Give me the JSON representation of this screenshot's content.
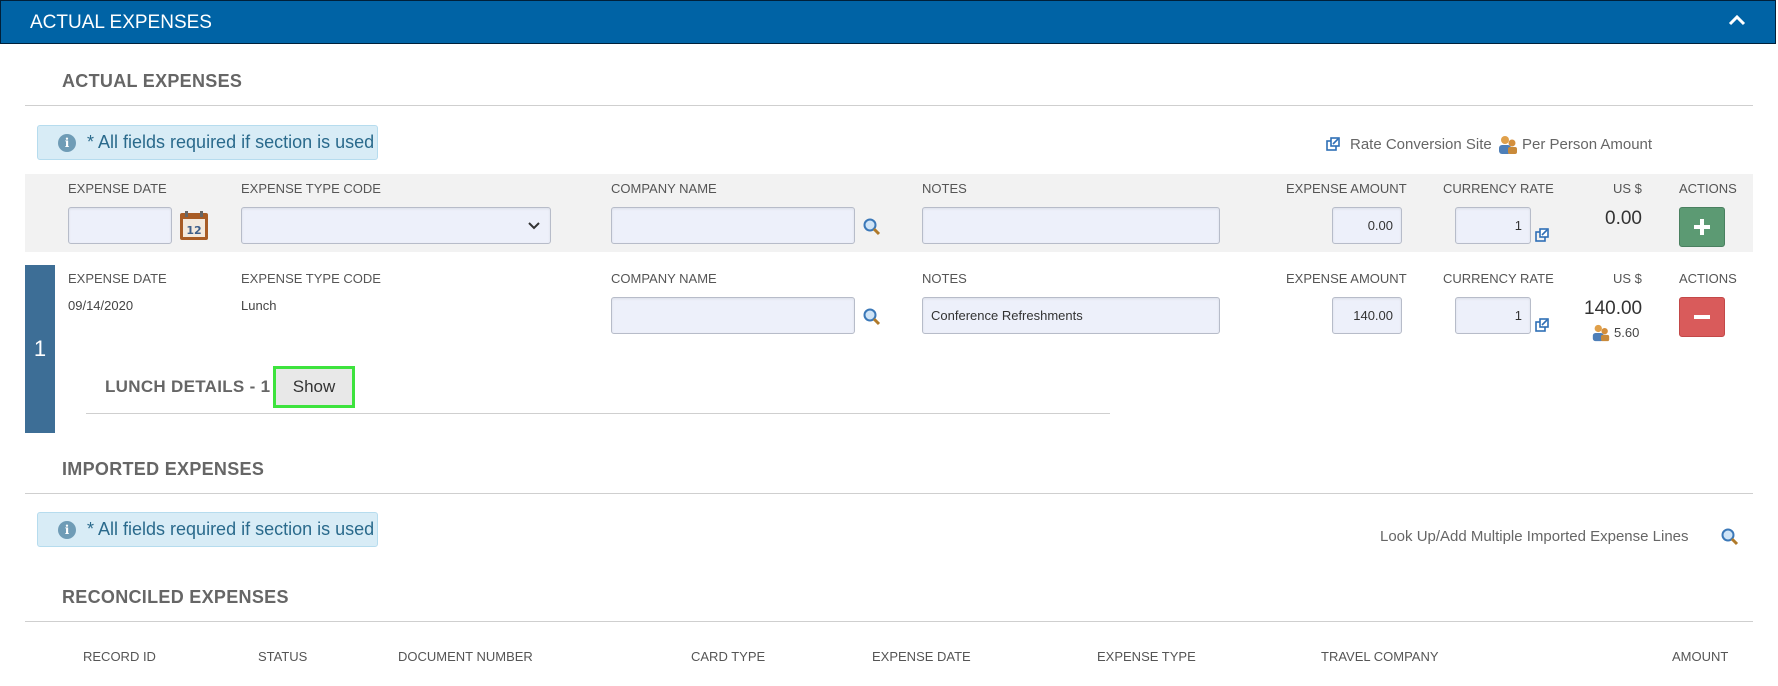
{
  "header": {
    "title": "ACTUAL EXPENSES"
  },
  "actual": {
    "title": "ACTUAL EXPENSES",
    "info": "* All fields required if section is used",
    "links": {
      "rate_conversion": "Rate Conversion Site",
      "per_person": "Per Person Amount"
    },
    "columns": {
      "expense_date": "EXPENSE DATE",
      "expense_type": "EXPENSE TYPE CODE",
      "company": "COMPANY NAME",
      "notes": "NOTES",
      "amount": "EXPENSE AMOUNT",
      "rate": "CURRENCY RATE",
      "usd": "US $",
      "actions": "ACTIONS"
    },
    "new_row": {
      "date": "",
      "type": "",
      "company": "",
      "notes": "",
      "amount": "0.00",
      "rate": "1",
      "usd": "0.00"
    },
    "row1": {
      "number": "1",
      "date": "09/14/2020",
      "type": "Lunch",
      "company": "",
      "notes": "Conference Refreshments",
      "amount": "140.00",
      "rate": "1",
      "usd": "140.00",
      "per_person": "5.60",
      "details_label": "LUNCH DETAILS - 1",
      "show_label": "Show"
    }
  },
  "imported": {
    "title": "IMPORTED EXPENSES",
    "info": "* All fields required if section is used",
    "lookup": "Look Up/Add Multiple Imported Expense Lines"
  },
  "reconciled": {
    "title": "RECONCILED EXPENSES",
    "columns": [
      "RECORD ID",
      "STATUS",
      "DOCUMENT NUMBER",
      "CARD TYPE",
      "EXPENSE DATE",
      "EXPENSE TYPE",
      "TRAVEL COMPANY",
      "AMOUNT"
    ]
  },
  "colors": {
    "header_bg": "#0063a5",
    "row_bar": "#3d6e96",
    "add_button": "#5c9a73",
    "delete_button": "#d95b5b",
    "show_highlight": "#3de33d"
  }
}
